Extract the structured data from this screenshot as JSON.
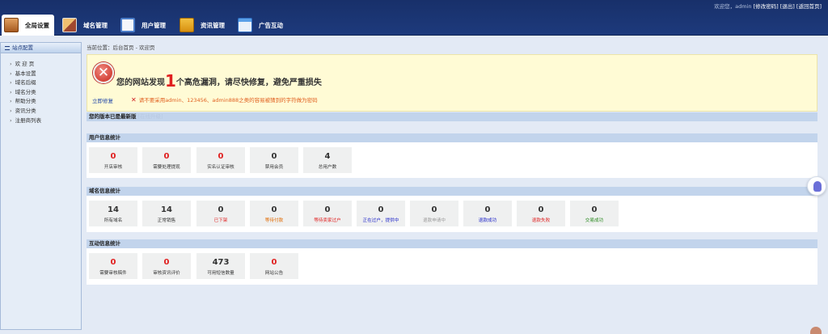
{
  "topbar": {
    "welcome": "欢迎您，admin",
    "links": [
      "[修改密码]",
      "[退出]",
      "[返回首页]"
    ]
  },
  "tabs": [
    {
      "label": "全局设置",
      "icon": "settings-icon",
      "active": true
    },
    {
      "label": "域名管理",
      "icon": "domain-icon",
      "active": false
    },
    {
      "label": "用户管理",
      "icon": "user-card-icon",
      "active": false
    },
    {
      "label": "资讯管理",
      "icon": "news-folder-icon",
      "active": false
    },
    {
      "label": "广告互动",
      "icon": "ad-window-icon",
      "active": false
    }
  ],
  "sidebar": {
    "header": "站点配置",
    "items": [
      "欢 迎 页",
      "基本设置",
      "域名后缀",
      "域名分类",
      "帮助分类",
      "资讯分类",
      "注册商列表"
    ]
  },
  "breadcrumb": "当前位置：后台首页 - 欢迎页",
  "alert": {
    "prefix": "您的网站发现",
    "count": "1",
    "suffix": "个高危漏洞，请尽快修复，避免严重损失",
    "fix_link": "立即修复",
    "tip": "请不要采用admin、123456、admin888之类的容易被猜到的字符做为密码"
  },
  "version": {
    "text": "您的版本已是最新版",
    "link": "[在线升级]"
  },
  "user_stats": {
    "title": "用户信息统计",
    "cards": [
      {
        "value": "0",
        "label": "开店审核",
        "value_color": "red",
        "label_color": "default"
      },
      {
        "value": "0",
        "label": "需要处理提现",
        "value_color": "red",
        "label_color": "default"
      },
      {
        "value": "0",
        "label": "实名认证审核",
        "value_color": "red",
        "label_color": "default"
      },
      {
        "value": "0",
        "label": "禁用会员",
        "value_color": "default",
        "label_color": "default"
      },
      {
        "value": "4",
        "label": "总用户数",
        "value_color": "default",
        "label_color": "default"
      }
    ]
  },
  "domain_stats": {
    "title": "域名信息统计",
    "cards": [
      {
        "value": "14",
        "label": "所有域名",
        "value_color": "default",
        "label_color": "default"
      },
      {
        "value": "14",
        "label": "正常销售",
        "value_color": "default",
        "label_color": "default"
      },
      {
        "value": "0",
        "label": "已下架",
        "value_color": "default",
        "label_color": "red"
      },
      {
        "value": "0",
        "label": "等待付款",
        "value_color": "default",
        "label_color": "orange"
      },
      {
        "value": "0",
        "label": "等待卖家过户",
        "value_color": "default",
        "label_color": "red"
      },
      {
        "value": "0",
        "label": "正在过户，提供中",
        "value_color": "default",
        "label_color": "blue"
      },
      {
        "value": "0",
        "label": "退款申请中",
        "value_color": "default",
        "label_color": "gray"
      },
      {
        "value": "0",
        "label": "退款成功",
        "value_color": "default",
        "label_color": "blue"
      },
      {
        "value": "0",
        "label": "退款失败",
        "value_color": "default",
        "label_color": "red"
      },
      {
        "value": "0",
        "label": "交易成功",
        "value_color": "default",
        "label_color": "green"
      }
    ]
  },
  "interact_stats": {
    "title": "互动信息统计",
    "cards": [
      {
        "value": "0",
        "label": "需要审核稿件",
        "value_color": "red",
        "label_color": "default"
      },
      {
        "value": "0",
        "label": "审核资讯评价",
        "value_color": "red",
        "label_color": "default"
      },
      {
        "value": "473",
        "label": "可用短信数量",
        "value_color": "default",
        "label_color": "default"
      },
      {
        "value": "0",
        "label": "网站公告",
        "value_color": "red",
        "label_color": "default"
      }
    ]
  },
  "colors": {
    "topbar": "#1d3a7c",
    "accent_red": "#e02020",
    "section_bar": "#c2d4ec",
    "alert_bg": "#fffbd5"
  }
}
